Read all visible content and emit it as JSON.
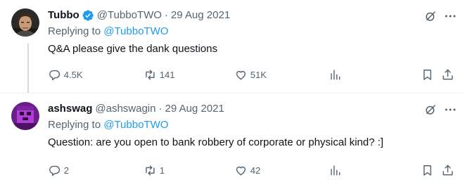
{
  "tweets": [
    {
      "name": "Tubbo",
      "verified": true,
      "handle": "@TubboTWO",
      "separator": "·",
      "date": "29 Aug 2021",
      "replying_prefix": "Replying to ",
      "replying_to": "@TubboTWO",
      "text": "Q&A please give the dank questions",
      "replies": "4.5K",
      "reposts": "141",
      "likes": "51K",
      "views": "",
      "avatar_colors": {
        "bg": "#2b2a26",
        "skin": "#c89a78",
        "hair": "#3a2a1e"
      }
    },
    {
      "name": "ashswag",
      "verified": false,
      "handle": "@ashswagin",
      "separator": "·",
      "date": "29 Aug 2021",
      "replying_prefix": "Replying to ",
      "replying_to": "@TubboTWO",
      "text": "Question: are you open to bank robbery of corporate or physical kind? :]",
      "replies": "2",
      "reposts": "1",
      "likes": "42",
      "views": "",
      "avatar_colors": {
        "bg": "#6a1f8a",
        "accent": "#b13cd6",
        "dark": "#2c0a3c"
      }
    }
  ],
  "icons": {
    "verified": "verified-badge-icon",
    "grok": "grok-icon",
    "more": "more-icon",
    "reply": "reply-icon",
    "repost": "repost-icon",
    "like": "like-icon",
    "views": "views-icon",
    "bookmark": "bookmark-icon",
    "share": "share-icon"
  },
  "colors": {
    "link": "#1d9bf0",
    "secondary_text": "#536471",
    "primary_text": "#0f1419",
    "divider": "#eff3f4",
    "thread_line": "#cfd9de"
  }
}
